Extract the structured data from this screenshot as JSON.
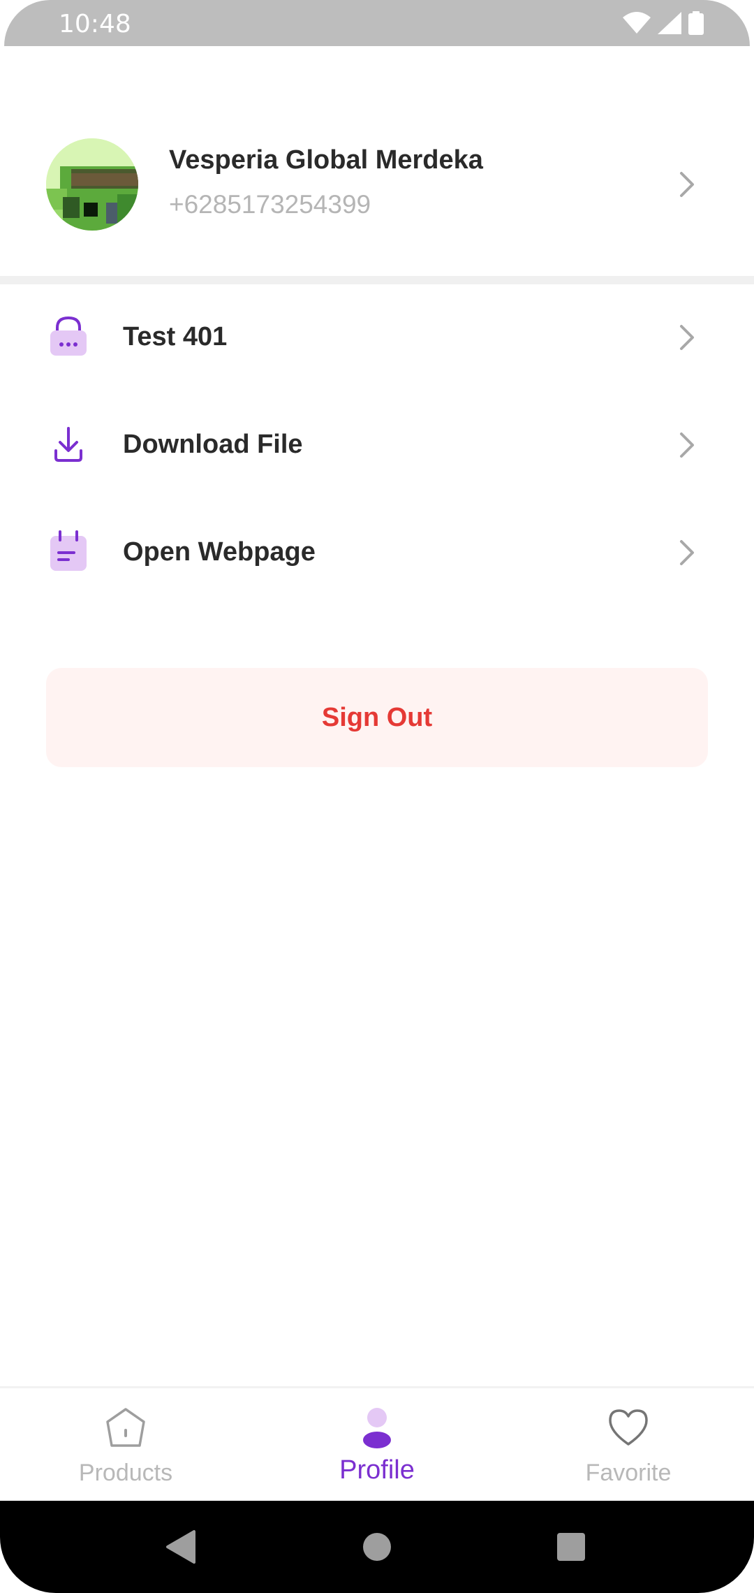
{
  "status_bar": {
    "time": "10:48",
    "icons": [
      "wifi-icon",
      "signal-icon",
      "battery-icon"
    ]
  },
  "profile": {
    "name": "Vesperia Global Merdeka",
    "phone": "+6285173254399",
    "avatar": "pixel-avatar"
  },
  "menu": {
    "items": [
      {
        "label": "Test 401",
        "icon": "lock-icon"
      },
      {
        "label": "Download File",
        "icon": "download-icon"
      },
      {
        "label": "Open Webpage",
        "icon": "calendar-note-icon"
      }
    ]
  },
  "signout": {
    "label": "Sign Out"
  },
  "bottom_nav": {
    "items": [
      {
        "label": "Products",
        "icon": "home-icon",
        "active": false
      },
      {
        "label": "Profile",
        "icon": "person-icon",
        "active": true
      },
      {
        "label": "Favorite",
        "icon": "heart-icon",
        "active": false
      }
    ]
  },
  "colors": {
    "accent": "#7b2fd0",
    "accent_light": "#e4c8f5",
    "danger": "#e53935",
    "danger_bg": "#fff3f2",
    "muted": "#b8b8b8"
  }
}
